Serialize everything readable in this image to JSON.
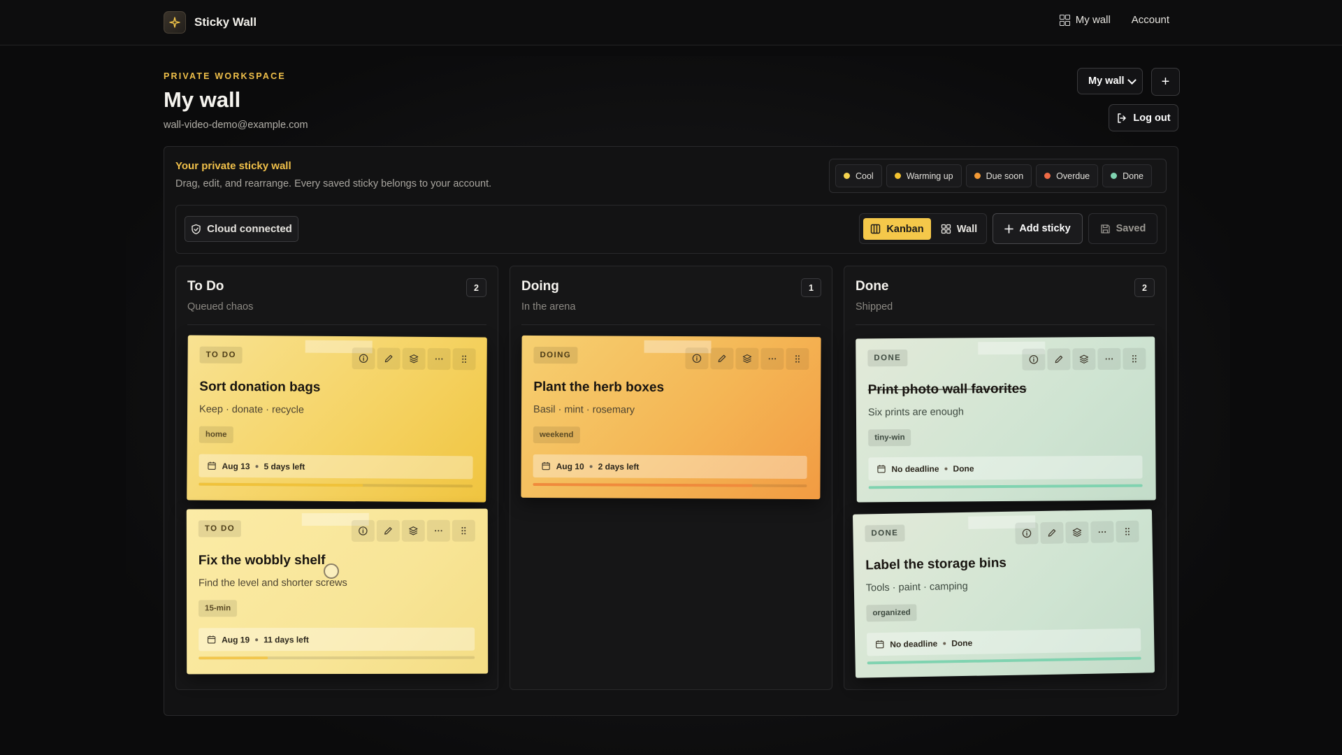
{
  "app": {
    "name": "Sticky Wall"
  },
  "nav": {
    "my_wall": "My wall",
    "account": "Account"
  },
  "header": {
    "eyebrow": "PRIVATE WORKSPACE",
    "title": "My wall",
    "email": "wall-video-demo@example.com",
    "wall_select": "My wall",
    "add_wall": "+",
    "logout": "Log out"
  },
  "intro": {
    "title": "Your private sticky wall",
    "subtitle": "Drag, edit, and rearrange. Every saved sticky belongs to your account."
  },
  "legend": [
    {
      "label": "Cool",
      "color": "#f5d34f"
    },
    {
      "label": "Warming up",
      "color": "#f2c230"
    },
    {
      "label": "Due soon",
      "color": "#f39a36"
    },
    {
      "label": "Overdue",
      "color": "#ef6b46"
    },
    {
      "label": "Done",
      "color": "#7fd3b0"
    }
  ],
  "toolbar": {
    "cloud": "Cloud connected",
    "view_kanban": "Kanban",
    "view_wall": "Wall",
    "add_sticky": "Add sticky",
    "saved": "Saved"
  },
  "columns": [
    {
      "title": "To Do",
      "subtitle": "Queued chaos",
      "count": "2"
    },
    {
      "title": "Doing",
      "subtitle": "In the arena",
      "count": "1"
    },
    {
      "title": "Done",
      "subtitle": "Shipped",
      "count": "2"
    }
  ],
  "cards": [
    {
      "status": "TO DO",
      "title": "Sort donation bags",
      "subtitle": "Keep · donate · recycle",
      "tag": "home",
      "date": "Aug 13",
      "due": "5 days left",
      "progress": 0.6,
      "bar_color": "#f0c23a"
    },
    {
      "status": "TO DO",
      "title": "Fix the wobbly shelf",
      "subtitle": "Find the level and shorter screws",
      "tag": "15-min",
      "date": "Aug 19",
      "due": "11 days left",
      "progress": 0.25,
      "bar_color": "#f2c64c"
    },
    {
      "status": "DOING",
      "title": "Plant the herb boxes",
      "subtitle": "Basil · mint · rosemary",
      "tag": "weekend",
      "date": "Aug 10",
      "due": "2 days left",
      "progress": 0.8,
      "bar_color": "#f08a3c"
    },
    {
      "status": "DONE",
      "title": "Print photo wall favorites",
      "subtitle": "Six prints are enough",
      "tag": "tiny-win",
      "date": "No deadline",
      "due": "Done",
      "progress": 1,
      "bar_color": "#7fd3b0"
    },
    {
      "status": "DONE",
      "title": "Label the storage bins",
      "subtitle": "Tools · paint · camping",
      "tag": "organized",
      "date": "No deadline",
      "due": "Done",
      "progress": 1,
      "bar_color": "#7fd3b0"
    }
  ],
  "icons": {
    "brand": "sparkle-icon",
    "my_wall": "grid-icon",
    "logout": "log-out-icon",
    "cloud": "shield-check-icon",
    "kanban": "columns-icon",
    "wall": "grid-icon",
    "add": "plus-icon",
    "saved": "save-icon",
    "card_actions": [
      "info-icon",
      "pencil-icon",
      "layers-icon",
      "more-icon",
      "drag-handle-icon"
    ],
    "calendar": "calendar-icon"
  }
}
